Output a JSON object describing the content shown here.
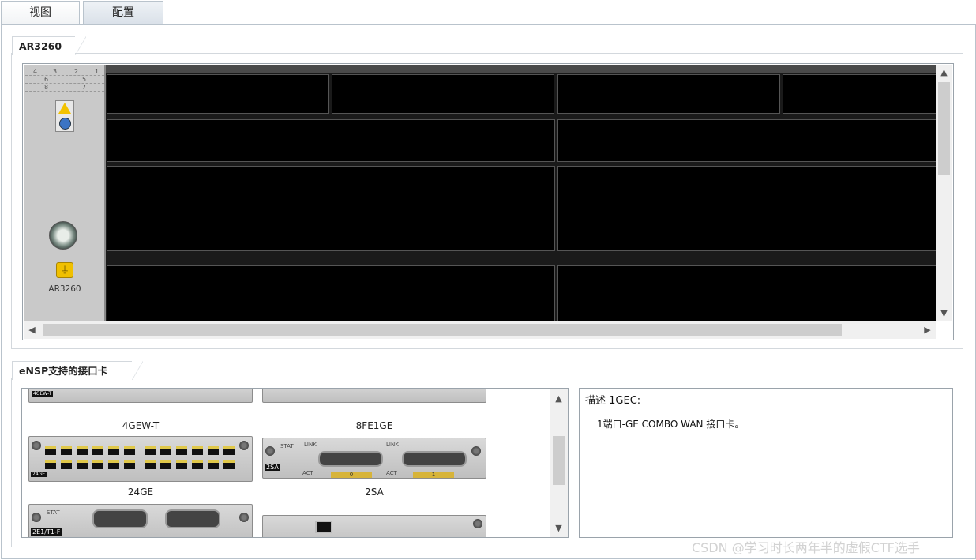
{
  "tabs": {
    "view": "视图",
    "config": "配置"
  },
  "device_panel": {
    "title": "AR3260",
    "model_label": "AR3260",
    "slot_map": [
      "4",
      "3",
      "2",
      "1",
      "6",
      "5",
      "8",
      "7"
    ]
  },
  "cards_panel": {
    "title": "eNSP支持的接口卡",
    "cards": [
      "4GEW-T",
      "8FE1GE",
      "24GE",
      "2SA"
    ],
    "strip_labels": [
      "0",
      "1"
    ],
    "port_text": [
      "STAT",
      "LINK",
      "ACT",
      "LINK",
      "ACT"
    ],
    "tag_texts": [
      "2SA",
      "24GE",
      "2E1/T1-F"
    ]
  },
  "description": {
    "title": "描述 1GEC:",
    "text": "1端口-GE COMBO WAN 接口卡。"
  },
  "watermark": "CSDN @学习时长两年半的虚假CTF选手"
}
